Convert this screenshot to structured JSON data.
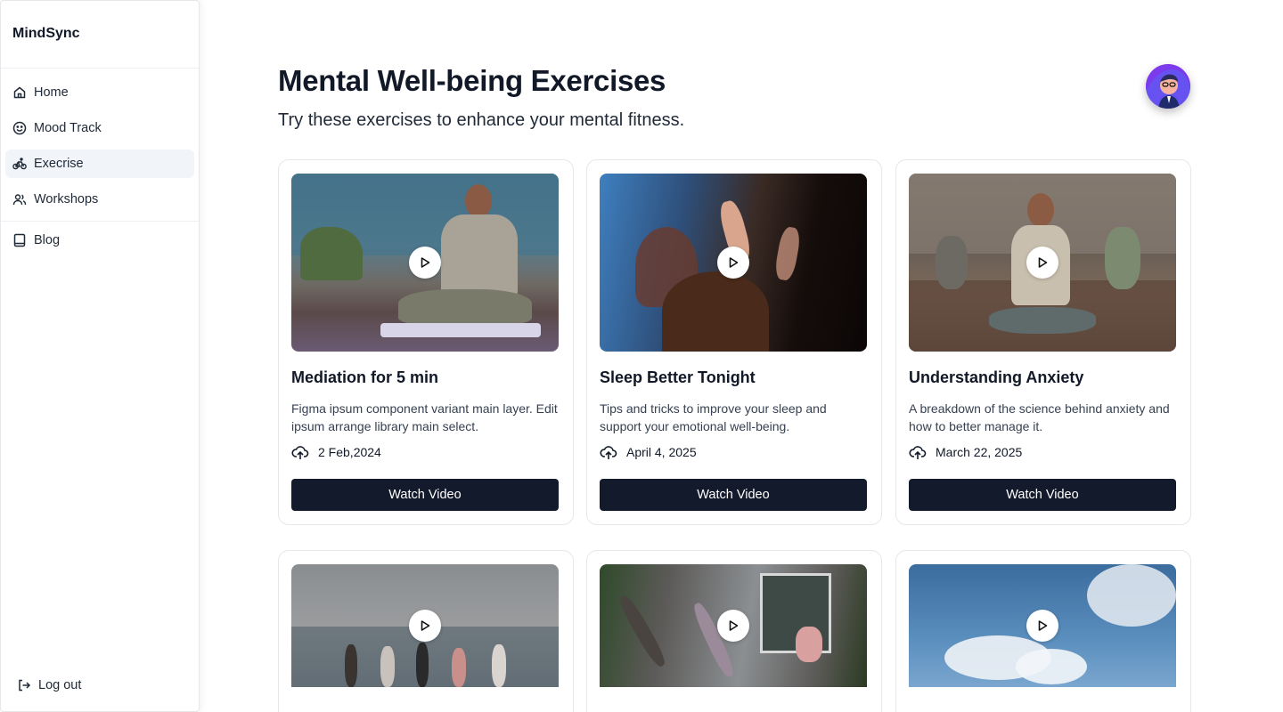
{
  "app": {
    "brand": "MindSync"
  },
  "sidebar": {
    "items": [
      {
        "label": "Home",
        "icon": "home-icon"
      },
      {
        "label": "Mood Track",
        "icon": "smiley-icon"
      },
      {
        "label": "Execrise",
        "icon": "bike-icon",
        "active": true
      },
      {
        "label": "Workshops",
        "icon": "users-icon"
      },
      {
        "label": "Blog",
        "icon": "book-icon"
      }
    ],
    "logout": {
      "label": "Log out",
      "icon": "logout-icon"
    }
  },
  "header": {
    "title": "Mental Well-being Exercises",
    "subtitle": "Try these exercises to enhance your mental fitness."
  },
  "cards": [
    {
      "title": "Mediation for 5 min",
      "description": "Figma ipsum component variant main layer. Edit ipsum arrange library main select.",
      "date": "2 Feb,2024",
      "button": "Watch Video"
    },
    {
      "title": "Sleep Better Tonight",
      "description": "Tips and tricks to improve your sleep and support your emotional well-being.",
      "date": "April 4, 2025",
      "button": "Watch Video"
    },
    {
      "title": "Understanding Anxiety",
      "description": "A breakdown of the science behind anxiety and how to better manage it.",
      "date": "March 22, 2025",
      "button": "Watch Video"
    }
  ],
  "colors": {
    "button_bg": "#131a2b",
    "active_nav_bg": "#f1f4f8",
    "text_primary": "#111827"
  }
}
